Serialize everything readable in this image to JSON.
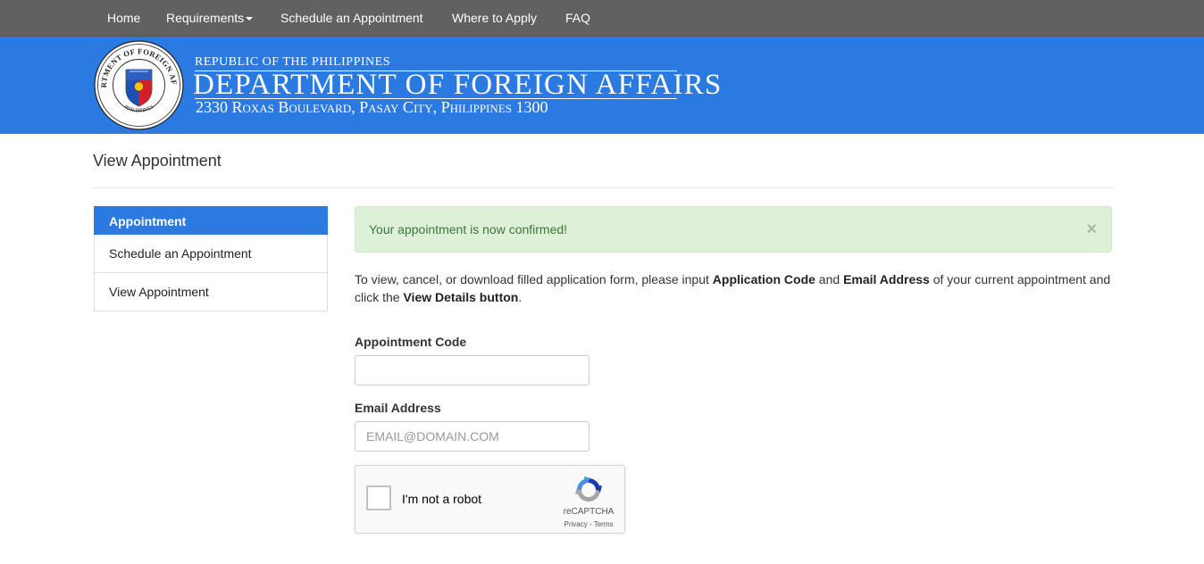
{
  "nav": {
    "items": [
      {
        "label": "Home"
      },
      {
        "label": "Requirements"
      },
      {
        "label": "Schedule an Appointment"
      },
      {
        "label": "Where to Apply"
      },
      {
        "label": "FAQ"
      }
    ]
  },
  "header": {
    "line1": "REPUBLIC OF THE PHILIPPINES",
    "line2": "DEPARTMENT OF FOREIGN AFFAIRS",
    "line3": "2330 Roxas Boulevard, Pasay City, Philippines 1300",
    "seal_text_top": "DEPARTMENT OF FOREIGN AFFAIRS",
    "seal_text_bottom": "PHILIPPINES",
    "brand_color": "#2a7ae2"
  },
  "page": {
    "title": "View Appointment"
  },
  "sidebar": {
    "heading": "Appointment",
    "items": [
      {
        "label": "Schedule an Appointment"
      },
      {
        "label": "View Appointment"
      }
    ]
  },
  "alert": {
    "message": "Your appointment is now confirmed!",
    "close": "×",
    "color": "#3c763d"
  },
  "instructions": {
    "part1": "To view, cancel, or download filled application form, please input ",
    "bold1": "Application Code",
    "part2": " and ",
    "bold2": "Email Address",
    "part3": " of your current appointment and click the ",
    "bold3": "View Details button",
    "part4": "."
  },
  "form": {
    "code_label": "Appointment Code",
    "code_value": "",
    "code_placeholder": "",
    "email_label": "Email Address",
    "email_value": "",
    "email_placeholder": "EMAIL@DOMAIN.COM"
  },
  "captcha": {
    "label": "I'm not a robot",
    "brand": "reCAPTCHA",
    "terms": "Privacy - Terms",
    "icon": "recaptcha-icon"
  }
}
